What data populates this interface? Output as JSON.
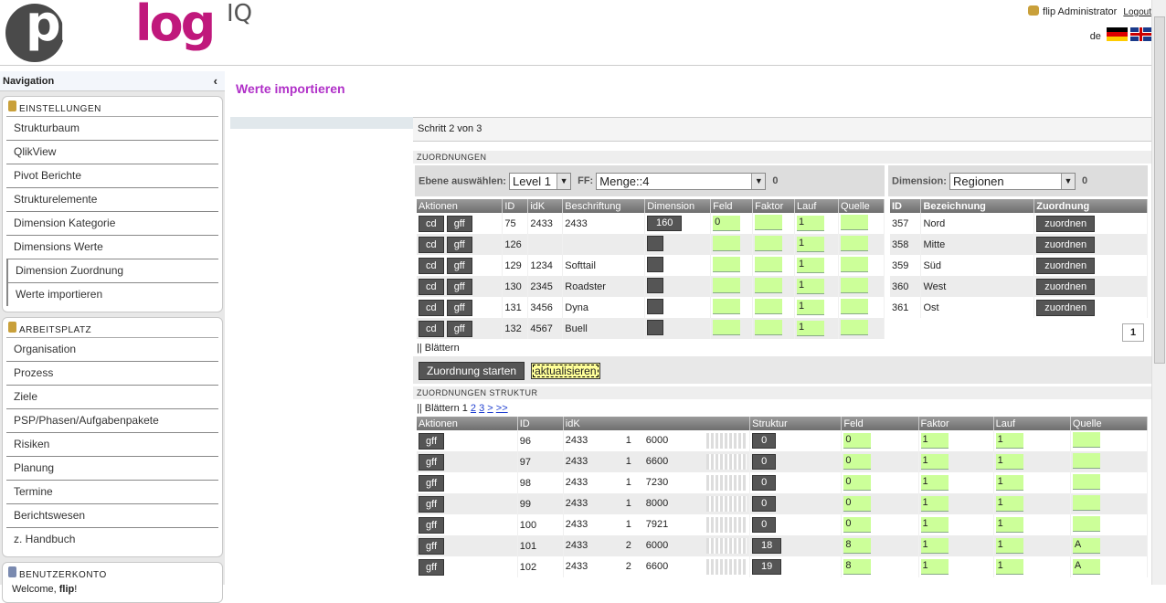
{
  "header": {
    "logo_main": "plan",
    "logo_accent": "log",
    "logo_suffix": "IQ",
    "user": "flip Administrator",
    "logout": "Logout",
    "lang": "de"
  },
  "sidebar": {
    "title": "Navigation",
    "sections": [
      {
        "title": "EINSTELLUNGEN",
        "items": [
          "Strukturbaum",
          "QlikView",
          "Pivot Berichte",
          "Strukturelemente",
          "Dimension Kategorie",
          "Dimensions Werte",
          "Dimension Zuordnung",
          "Werte importieren"
        ]
      },
      {
        "title": "ARBEITSPLATZ",
        "items": [
          "Organisation",
          "Prozess",
          "Ziele",
          "PSP/Phasen/Aufgabenpakete",
          "Risiken",
          "Planung",
          "Termine",
          "Berichtswesen",
          "z. Handbuch"
        ]
      },
      {
        "title": "BENUTZERKONTO",
        "welcome": "Welcome, ",
        "welcome_user": "flip",
        "welcome_end": "!"
      }
    ]
  },
  "main": {
    "title": "Werte importieren",
    "step": "Schritt 2 von 3",
    "section1": "ZUORDNUNGEN",
    "filter": {
      "ebene_label": "Ebene auswählen:",
      "ebene_value": "Level 1",
      "ff_label": "FF:",
      "ff_value": "Menge::4",
      "count": "0",
      "dimension_label": "Dimension:",
      "dimension_value": "Regionen",
      "dim_count": "0"
    },
    "table1": {
      "headers": [
        "Aktionen",
        "ID",
        "idK",
        "Beschriftung",
        "Dimension",
        "Feld",
        "Faktor",
        "Lauf",
        "Quelle"
      ],
      "rows": [
        {
          "id": "75",
          "idk": "2433",
          "label": "2433",
          "dim": "160",
          "feld": "0",
          "faktor": "",
          "lauf": "1",
          "quelle": ""
        },
        {
          "id": "126",
          "idk": "",
          "label": "",
          "dim": "",
          "feld": "",
          "faktor": "",
          "lauf": "1",
          "quelle": ""
        },
        {
          "id": "129",
          "idk": "1234",
          "label": "Softtail",
          "dim": "",
          "feld": "",
          "faktor": "",
          "lauf": "1",
          "quelle": ""
        },
        {
          "id": "130",
          "idk": "2345",
          "label": "Roadster",
          "dim": "",
          "feld": "",
          "faktor": "",
          "lauf": "1",
          "quelle": ""
        },
        {
          "id": "131",
          "idk": "3456",
          "label": "Dyna",
          "dim": "",
          "feld": "",
          "faktor": "",
          "lauf": "1",
          "quelle": ""
        },
        {
          "id": "132",
          "idk": "4567",
          "label": "Buell",
          "dim": "",
          "feld": "",
          "faktor": "",
          "lauf": "1",
          "quelle": ""
        }
      ],
      "btn_cd": "cd",
      "btn_gff": "gff"
    },
    "table2": {
      "headers": [
        "ID",
        "Bezeichnung",
        "Zuordnung"
      ],
      "rows": [
        {
          "id": "357",
          "name": "Nord"
        },
        {
          "id": "358",
          "name": "Mitte"
        },
        {
          "id": "359",
          "name": "Süd"
        },
        {
          "id": "360",
          "name": "West"
        },
        {
          "id": "361",
          "name": "Ost"
        }
      ],
      "btn": "zuordnen",
      "page": "1"
    },
    "blaettern1": "|| Blättern",
    "btn_start": "Zuordnung starten",
    "btn_update": "aktualisieren",
    "section2": "ZUORDNUNGEN STRUKTUR",
    "blaettern2": {
      "prefix": "|| Blättern 1 ",
      "p2": "2",
      "p3": "3",
      "next": ">",
      "last": ">>"
    },
    "table3": {
      "headers": [
        "Aktionen",
        "ID",
        "idK",
        "Struktur",
        "Feld",
        "Faktor",
        "Lauf",
        "Quelle"
      ],
      "rows": [
        {
          "id": "96",
          "idk": "2433",
          "lvl": "1",
          "code": "6000",
          "struct": "0",
          "feld": "0",
          "faktor": "1",
          "lauf": "1",
          "quelle": ""
        },
        {
          "id": "97",
          "idk": "2433",
          "lvl": "1",
          "code": "6600",
          "struct": "0",
          "feld": "0",
          "faktor": "1",
          "lauf": "1",
          "quelle": ""
        },
        {
          "id": "98",
          "idk": "2433",
          "lvl": "1",
          "code": "7230",
          "struct": "0",
          "feld": "0",
          "faktor": "1",
          "lauf": "1",
          "quelle": ""
        },
        {
          "id": "99",
          "idk": "2433",
          "lvl": "1",
          "code": "8000",
          "struct": "0",
          "feld": "0",
          "faktor": "1",
          "lauf": "1",
          "quelle": ""
        },
        {
          "id": "100",
          "idk": "2433",
          "lvl": "1",
          "code": "7921",
          "struct": "0",
          "feld": "0",
          "faktor": "1",
          "lauf": "1",
          "quelle": ""
        },
        {
          "id": "101",
          "idk": "2433",
          "lvl": "2",
          "code": "6000",
          "struct": "18",
          "feld": "8",
          "faktor": "1",
          "lauf": "1",
          "quelle": "A"
        },
        {
          "id": "102",
          "idk": "2433",
          "lvl": "2",
          "code": "6600",
          "struct": "19",
          "feld": "8",
          "faktor": "1",
          "lauf": "1",
          "quelle": "A"
        }
      ],
      "btn_gff": "gff"
    }
  }
}
